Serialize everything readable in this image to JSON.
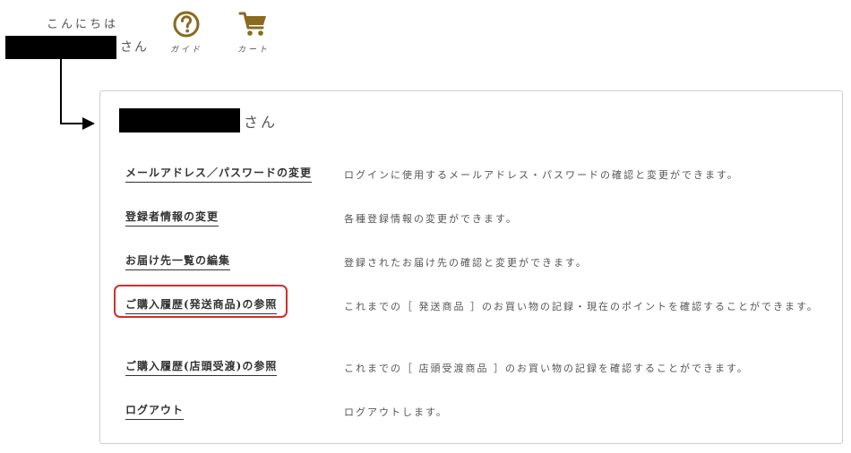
{
  "header": {
    "greeting": "こんにちは",
    "honorific": "さん",
    "nav": {
      "guide_label": "ガイド",
      "cart_label": "カート"
    }
  },
  "panel": {
    "honorific": "さん",
    "menu": [
      {
        "link": "メールアドレス／パスワードの変更",
        "desc": "ログインに使用するメールアドレス・パスワードの確認と変更ができます。"
      },
      {
        "link": "登録者情報の変更",
        "desc": "各種登録情報の変更ができます。"
      },
      {
        "link": "お届け先一覧の編集",
        "desc": "登録されたお届け先の確認と変更ができます。"
      },
      {
        "link": "ご購入履歴(発送商品)の参照",
        "desc": "これまでの［ 発送商品 ］のお買い物の記録・現在のポイントを確認することができます。"
      },
      {
        "link": "ご購入履歴(店頭受渡)の参照",
        "desc": "これまでの［ 店頭受渡商品 ］のお買い物の記録を確認することができます。"
      },
      {
        "link": "ログアウト",
        "desc": "ログアウトします。"
      }
    ]
  },
  "colors": {
    "icon_brown": "#8a6a1f",
    "highlight_red": "#d0302b"
  },
  "icons": [
    "question-icon",
    "cart-icon"
  ]
}
